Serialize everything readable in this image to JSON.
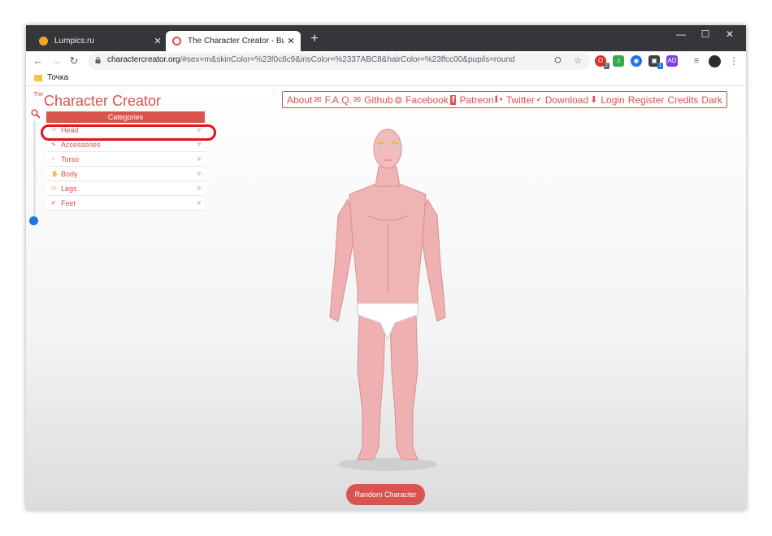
{
  "browser": {
    "tabs": [
      {
        "title": "Lumpics.ru",
        "favicon_color": "#f4a623",
        "active": false
      },
      {
        "title": "The Character Creator - Build visu",
        "favicon_color": "#d9534f",
        "active": true
      }
    ],
    "new_tab_symbol": "+",
    "window_controls": {
      "minimize": "—",
      "maximize": "☐",
      "close": "✕"
    },
    "nav": {
      "back": "←",
      "forward": "→",
      "reload": "↻"
    },
    "url_host": "charactercreator.org",
    "url_rest": "/#sex=m&skinColor=%23f0c8c9&irisColor=%2337ABC8&hairColor=%23ffcc00&pupils=round",
    "extensions": [
      {
        "icon": "opera-icon",
        "color": "#d93025",
        "label": "O",
        "badge": "2"
      },
      {
        "icon": "music-icon",
        "color": "#34a853",
        "label": "♫",
        "badge": ""
      },
      {
        "icon": "globe-icon",
        "color": "#1a73e8",
        "label": "◉",
        "badge": ""
      },
      {
        "icon": "box-icon",
        "color": "#3c4043",
        "label": "▣",
        "badge": "1"
      },
      {
        "icon": "ext-icon",
        "color": "#7b3fe4",
        "label": "AD",
        "badge": ""
      }
    ],
    "bookmarks": [
      {
        "label": "Точка"
      }
    ]
  },
  "site": {
    "logo_the": "The",
    "logo_name": "Character Creator",
    "nav": [
      {
        "label": "About",
        "icon": "✉"
      },
      {
        "label": "F.A.Q.",
        "icon": "✉"
      },
      {
        "label": "Github",
        "icon": "◍"
      },
      {
        "label": "Facebook",
        "icon": "f"
      },
      {
        "label": "Patreon",
        "icon": "▌●"
      },
      {
        "label": "Twitter",
        "icon": "✔"
      },
      {
        "label": "Download",
        "icon": "⬇"
      },
      {
        "label": "Login",
        "icon": ""
      },
      {
        "label": "Register",
        "icon": ""
      },
      {
        "label": "Credits",
        "icon": ""
      },
      {
        "label": "Dark",
        "icon": ""
      }
    ],
    "categories_title": "Categories",
    "categories": [
      {
        "label": "Head",
        "icon": "☺"
      },
      {
        "label": "Accessories",
        "icon": "✎"
      },
      {
        "label": "Torso",
        "icon": "♂"
      },
      {
        "label": "Body",
        "icon": "✋"
      },
      {
        "label": "Legs",
        "icon": "⚇"
      },
      {
        "label": "Feet",
        "icon": "✐"
      }
    ],
    "expand_symbol": "▿",
    "random_button": "Random Character",
    "accent_color": "#d9534f",
    "highlight_color": "#e2141b"
  }
}
